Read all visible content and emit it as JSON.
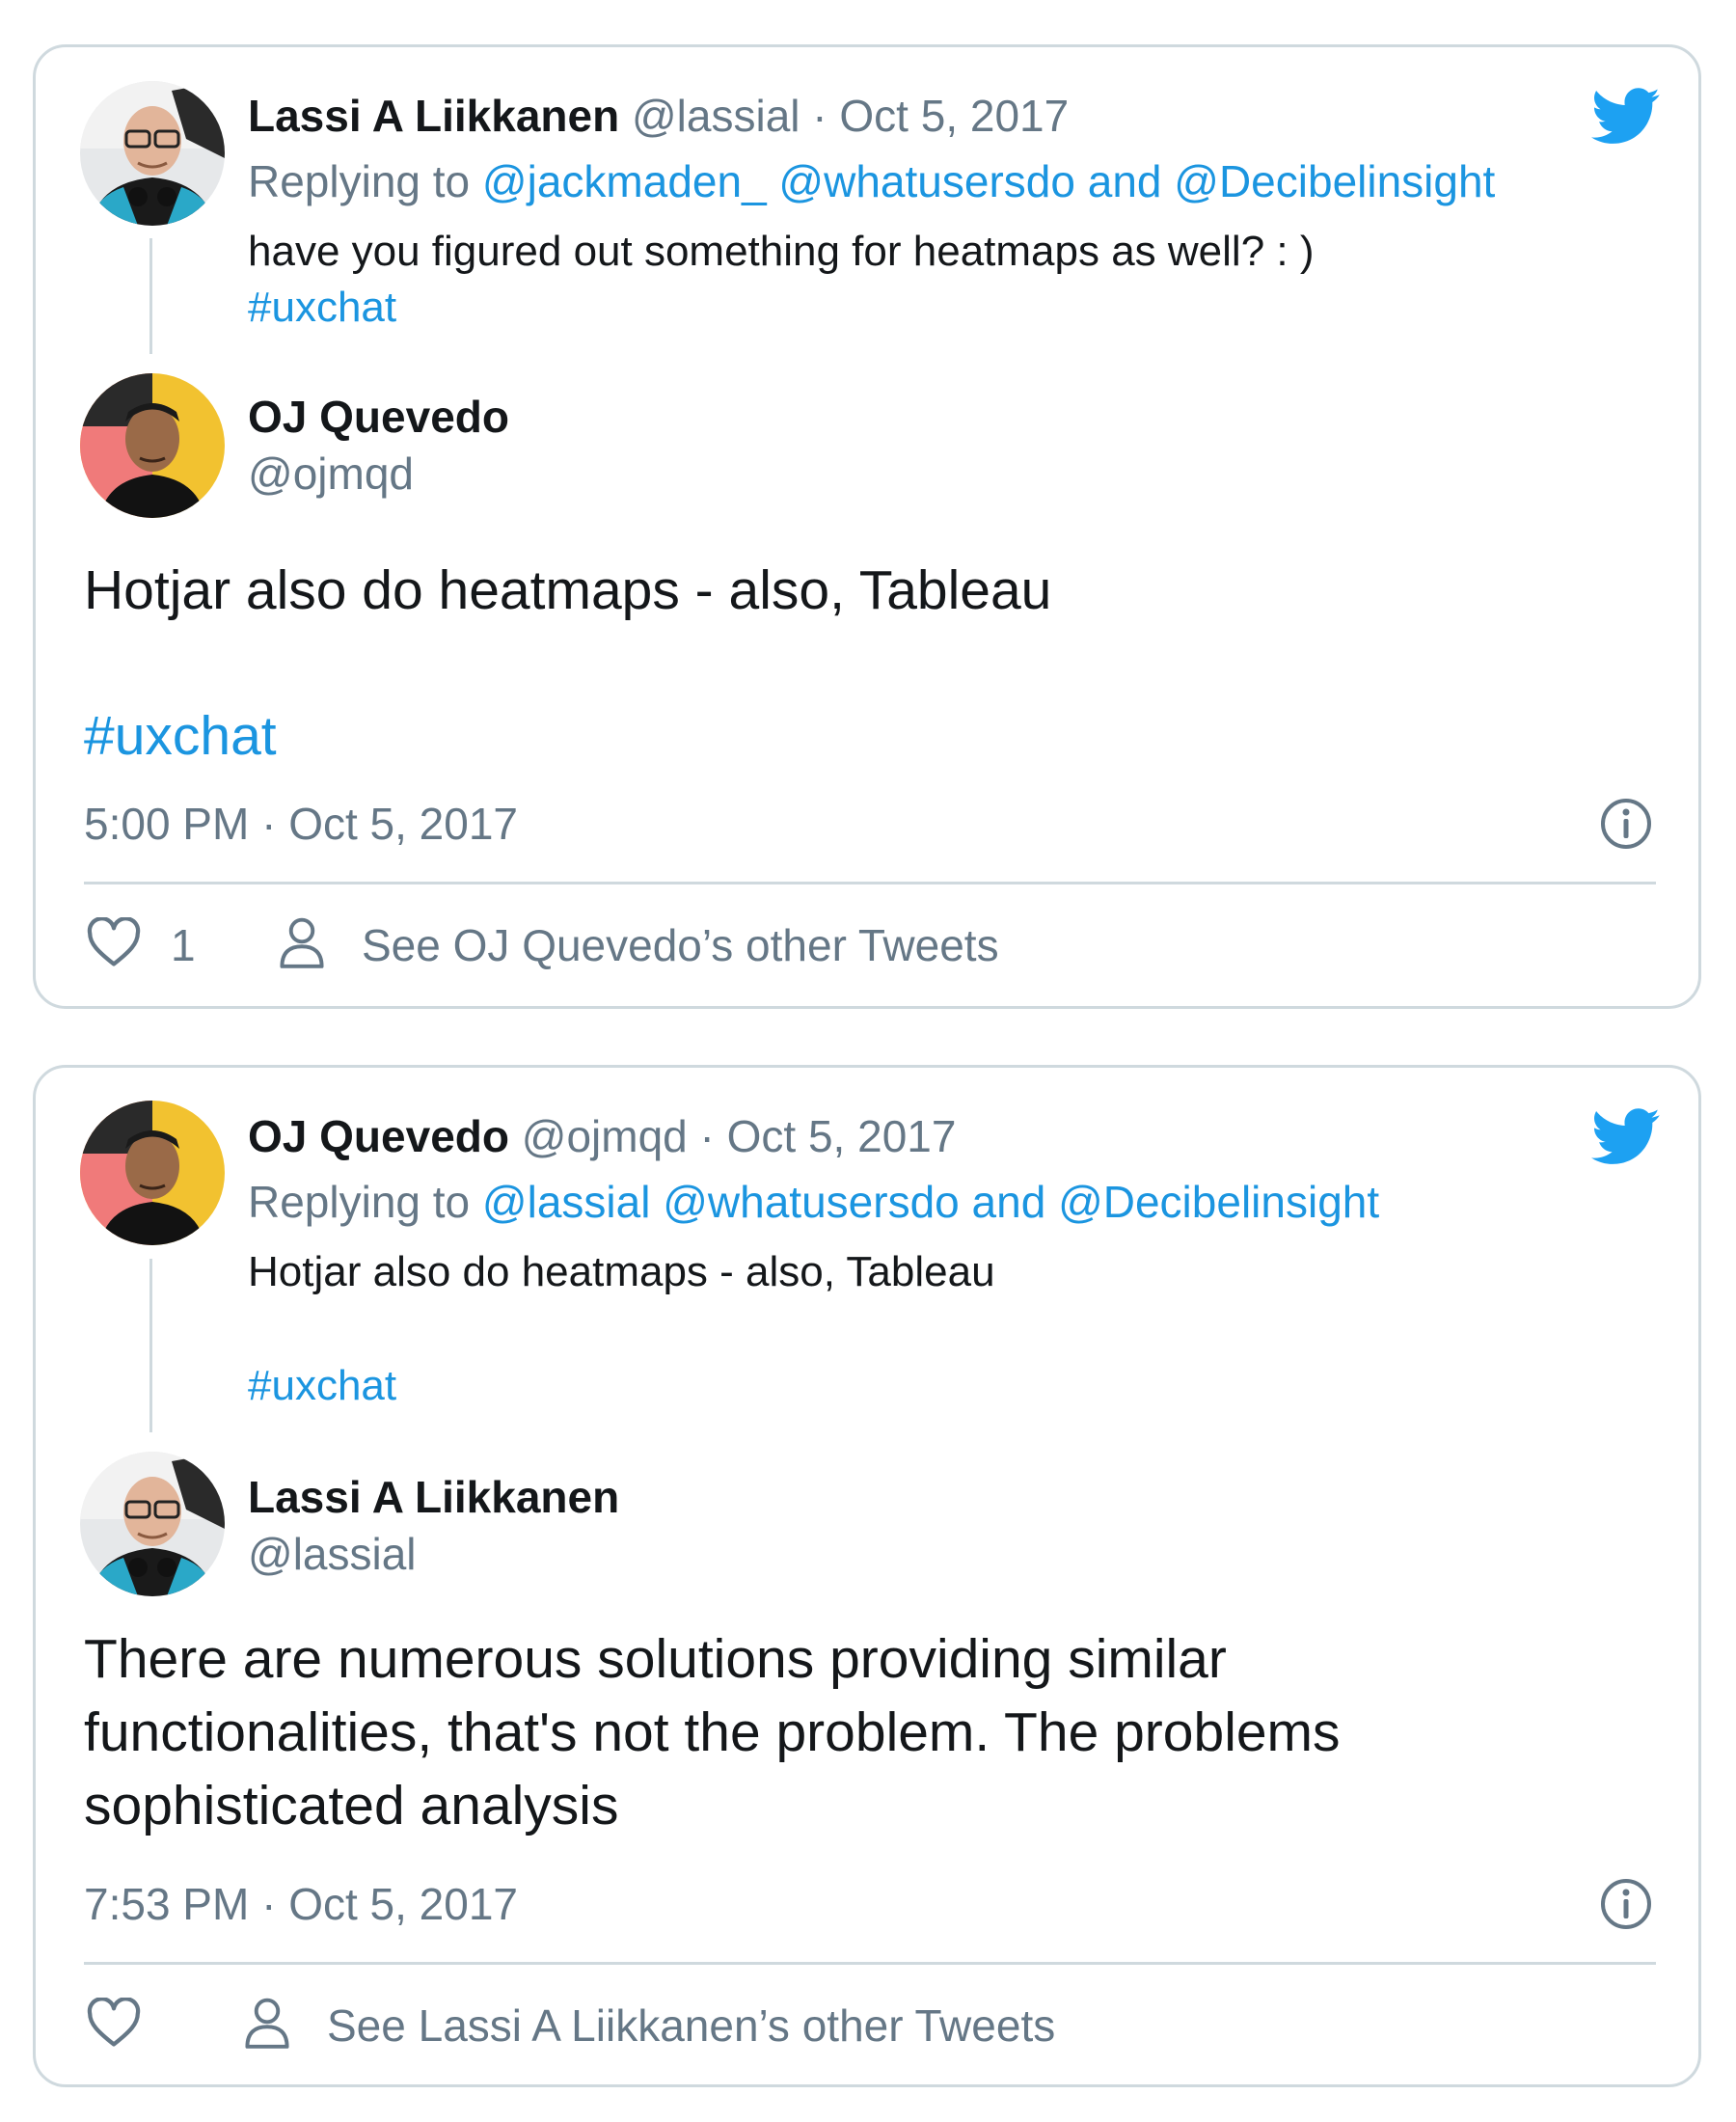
{
  "tweet1": {
    "context": {
      "author_name": "Lassi A Liikkanen",
      "author_handle": "@lassial",
      "date": "Oct 5, 2017",
      "replying_prefix": "Replying to",
      "replying_to": "@jackmaden_ @whatusersdo",
      "replying_and": "and",
      "replying_last": "@Decibelinsight",
      "text": "have you figured out something for heatmaps as well? : )",
      "hashtag": "#uxchat"
    },
    "main": {
      "author_name": "OJ Quevedo",
      "author_handle": "@ojmqd",
      "text": "Hotjar also do heatmaps - also, Tableau",
      "hashtag": "#uxchat",
      "timestamp": "5:00 PM · Oct 5, 2017"
    },
    "actions": {
      "like_count": "1",
      "see_other": "See OJ Quevedo’s other Tweets"
    }
  },
  "tweet2": {
    "context": {
      "author_name": "OJ Quevedo",
      "author_handle": "@ojmqd",
      "date": "Oct 5, 2017",
      "replying_prefix": "Replying to",
      "replying_to": "@lassial @whatusersdo",
      "replying_and": "and",
      "replying_last": "@Decibelinsight",
      "text": "Hotjar also do heatmaps - also, Tableau",
      "hashtag": "#uxchat"
    },
    "main": {
      "author_name": "Lassi A Liikkanen",
      "author_handle": "@lassial",
      "text_line1": "There are numerous solutions providing similar",
      "text_line2": "functionalities, that's not the problem.  The problems",
      "text_line3": "sophisticated analysis",
      "timestamp": "7:53 PM · Oct 5, 2017"
    },
    "actions": {
      "see_other": "See Lassi A Liikkanen’s other Tweets"
    }
  },
  "colors": {
    "link": "#1b95e0",
    "muted": "#657786",
    "border": "#cfd9de",
    "twitter_blue": "#1da1f2"
  },
  "icons": [
    "twitter-bird-icon",
    "info-icon",
    "heart-icon",
    "person-icon"
  ]
}
